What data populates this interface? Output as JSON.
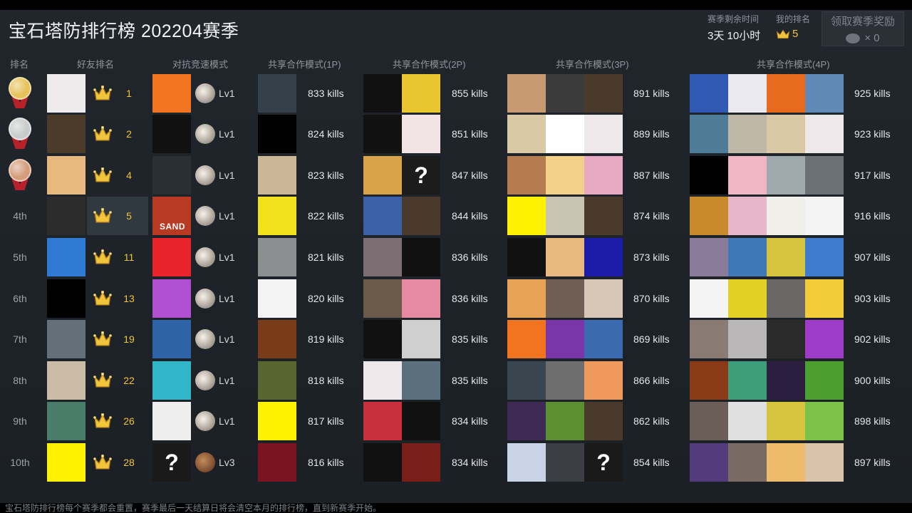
{
  "title": "宝石塔防排行榜 202204赛季",
  "season_remaining": {
    "label": "赛季剩余时间",
    "value": "3天 10小时"
  },
  "my_rank": {
    "label": "我的排名",
    "value": "5"
  },
  "claim_reward": {
    "label": "领取赛季奖励",
    "count": "× 0"
  },
  "headers": {
    "rank": "排名",
    "friends": "好友排名",
    "versus": "对抗竞速模式",
    "coop1": "共享合作模式(1P)",
    "coop2": "共享合作模式(2P)",
    "coop3": "共享合作模式(3P)",
    "coop4": "共享合作模式(4P)"
  },
  "colors": {
    "gold_text": "#f0c53c",
    "gold_medal": "#e6c25a",
    "silver_medal": "#c9cbcc",
    "bronze_medal": "#d59d7c"
  },
  "rows": [
    {
      "rank_text": "",
      "medal": "gold",
      "friend_score": "1",
      "versus_level": "Lv1",
      "coop1_kills": "833 kills",
      "coop2_kills": "855 kills",
      "coop3_kills": "891 kills",
      "coop4_kills": "925 kills",
      "friend_color": "#efeaec",
      "versus_color": "#f2741f",
      "c1": [
        "#35404a"
      ],
      "c2": [
        "#111111",
        "#e9c630"
      ],
      "c3": [
        "#c79a72",
        "#3b3b3b",
        "#4a3a2c"
      ],
      "c4": [
        "#3059b4",
        "#e9e9ef",
        "#e86a1c",
        "#5f8ab8"
      ]
    },
    {
      "rank_text": "",
      "medal": "silver",
      "friend_score": "2",
      "versus_level": "Lv1",
      "coop1_kills": "824 kills",
      "coop2_kills": "851 kills",
      "coop3_kills": "889 kills",
      "coop4_kills": "923 kills",
      "friend_color": "#4d3b2a",
      "versus_color": "#111111",
      "c1": [
        "#000000"
      ],
      "c2": [
        "#111111",
        "#f2e4e4"
      ],
      "c3": [
        "#d8c9a4",
        "#ffffff",
        "#efe8ea"
      ],
      "c4": [
        "#4e7c96",
        "#bfb8a8",
        "#d8c9a4",
        "#efe8ea"
      ]
    },
    {
      "rank_text": "",
      "medal": "bronze",
      "friend_score": "4",
      "versus_level": "Lv1",
      "coop1_kills": "823 kills",
      "coop2_kills": "847 kills",
      "coop3_kills": "887 kills",
      "coop4_kills": "917 kills",
      "friend_color": "#e8b97f",
      "versus_color": "#2a2f34",
      "c1": [
        "#cbb796"
      ],
      "c2": [
        "#d9a34a",
        "#1c1c1c"
      ],
      "c3": [
        "#b57d4f",
        "#f2d08a",
        "#e8a9c3"
      ],
      "c4": [
        "#000000",
        "#f0b6c4",
        "#9fa9ae",
        "#6b7076"
      ]
    },
    {
      "rank_text": "4th",
      "medal": "",
      "friend_score": "5",
      "versus_level": "Lv1",
      "coop1_kills": "822 kills",
      "coop2_kills": "844 kills",
      "coop3_kills": "874 kills",
      "coop4_kills": "916 kills",
      "friend_color": "#2c2c2c",
      "versus_color": "#b93a22",
      "c1": [
        "#f1e11e"
      ],
      "c2": [
        "#3b5fa8",
        "#4a3a2c"
      ],
      "c3": [
        "#fff200",
        "#c9c3b3",
        "#4a3a2c"
      ],
      "c4": [
        "#c98a2c",
        "#e6b7c9",
        "#f1efe9",
        "#f4f4f4"
      ]
    },
    {
      "rank_text": "5th",
      "medal": "",
      "friend_score": "11",
      "versus_level": "Lv1",
      "coop1_kills": "821 kills",
      "coop2_kills": "836 kills",
      "coop3_kills": "873 kills",
      "coop4_kills": "907 kills",
      "friend_color": "#2f7bd4",
      "versus_color": "#e8242a",
      "c1": [
        "#8c8f90"
      ],
      "c2": [
        "#7b6f73",
        "#111111"
      ],
      "c3": [
        "#111111",
        "#e8b97f",
        "#1c1ca8"
      ],
      "c4": [
        "#8a7b9a",
        "#3f78b6",
        "#d7c43e",
        "#3e7ccf"
      ]
    },
    {
      "rank_text": "6th",
      "medal": "",
      "friend_score": "13",
      "versus_level": "Lv1",
      "coop1_kills": "820 kills",
      "coop2_kills": "836 kills",
      "coop3_kills": "870 kills",
      "coop4_kills": "903 kills",
      "friend_color": "#000000",
      "versus_color": "#b04fd0",
      "c1": [
        "#f3f3f3"
      ],
      "c2": [
        "#6b5a4a",
        "#e68aa4"
      ],
      "c3": [
        "#e7a256",
        "#6e5e54",
        "#d8c7b7"
      ],
      "c4": [
        "#f4f4f4",
        "#e2d024",
        "#6c6767",
        "#f2cc3a"
      ]
    },
    {
      "rank_text": "7th",
      "medal": "",
      "friend_score": "19",
      "versus_level": "Lv1",
      "coop1_kills": "819 kills",
      "coop2_kills": "835 kills",
      "coop3_kills": "869 kills",
      "coop4_kills": "902 kills",
      "friend_color": "#63707a",
      "versus_color": "#2e63a8",
      "c1": [
        "#7a3b18"
      ],
      "c2": [
        "#111111",
        "#cfcfcf"
      ],
      "c3": [
        "#f2741f",
        "#7a35a8",
        "#3a6bb0"
      ],
      "c4": [
        "#8a7b75",
        "#b9b7b8",
        "#2a2a2a",
        "#9e3bc8"
      ]
    },
    {
      "rank_text": "8th",
      "medal": "",
      "friend_score": "22",
      "versus_level": "Lv1",
      "coop1_kills": "818 kills",
      "coop2_kills": "835 kills",
      "coop3_kills": "866 kills",
      "coop4_kills": "900 kills",
      "friend_color": "#cbbca8",
      "versus_color": "#2fb6c9",
      "c1": [
        "#58652e"
      ],
      "c2": [
        "#efe8ea",
        "#5b6f7c"
      ],
      "c3": [
        "#39454f",
        "#6e6e6e",
        "#ef9a5c"
      ],
      "c4": [
        "#8a3a14",
        "#3d9e7c",
        "#2b1e3e",
        "#4b9f2f"
      ]
    },
    {
      "rank_text": "9th",
      "medal": "",
      "friend_score": "26",
      "versus_level": "Lv1",
      "coop1_kills": "817 kills",
      "coop2_kills": "834 kills",
      "coop3_kills": "862 kills",
      "coop4_kills": "898 kills",
      "friend_color": "#4a7c6a",
      "versus_color": "#eeeeee",
      "c1": [
        "#fff200"
      ],
      "c2": [
        "#c7303c",
        "#111111"
      ],
      "c3": [
        "#3f2a55",
        "#5b8f2f",
        "#4a3a2c"
      ],
      "c4": [
        "#6b5e58",
        "#e0e0e0",
        "#d7c43e",
        "#7cc24a"
      ]
    },
    {
      "rank_text": "10th",
      "medal": "",
      "friend_score": "28",
      "versus_level": "Lv3",
      "coop1_kills": "816 kills",
      "coop2_kills": "834 kills",
      "coop3_kills": "854 kills",
      "coop4_kills": "897 kills",
      "friend_color": "#fff200",
      "versus_color": "#1a1a1a",
      "c1": [
        "#7a1420"
      ],
      "c2": [
        "#111111",
        "#7a1e1a"
      ],
      "c3": [
        "#c9d3e8",
        "#3b3f45",
        "#1a1a1a"
      ],
      "c4": [
        "#533c7c",
        "#7a6a64",
        "#ecbb6c",
        "#d9c3a8"
      ]
    }
  ],
  "footer": "宝石塔防排行榜每个赛季都会重置，赛季最后一天结算日将会清空本月的排行榜，直到新赛季开始。"
}
